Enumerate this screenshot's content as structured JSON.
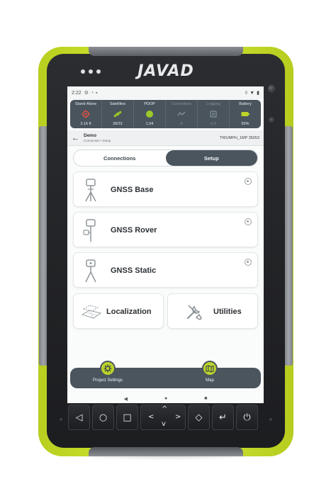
{
  "device": {
    "brand": "JAVAD",
    "lime_color": "#c9e12b",
    "bezel_color": "#232427"
  },
  "status_bar": {
    "time": "2:22",
    "icons": [
      "settings-icon",
      "sync-icon",
      "notification-icon"
    ],
    "right_icons": [
      "vibrate-icon",
      "wifi-icon",
      "battery-icon"
    ]
  },
  "gnss_panel": {
    "cells": [
      {
        "label": "Stand-Alone",
        "value": "3.16 ft",
        "color": "#e0523f",
        "icon": "target-icon",
        "dim": false
      },
      {
        "label": "Satellites",
        "value": "28/31",
        "color": "#9cc92a",
        "icon": "satellite-icon",
        "dim": false
      },
      {
        "label": "PDOP",
        "value": "1.04",
        "color": "#9cc92a",
        "icon": "dot-icon",
        "dim": false
      },
      {
        "label": "Corrections",
        "value": "0",
        "color": "#87939b",
        "icon": "signal-icon",
        "dim": true
      },
      {
        "label": "Logging",
        "value": "0.0",
        "color": "#87939b",
        "icon": "log-icon",
        "dim": true
      },
      {
        "label": "Battery",
        "value": "93%",
        "color": "#bcd42a",
        "icon": "battery-icon",
        "dim": false
      }
    ]
  },
  "title_bar": {
    "title": "Demo",
    "subtitle": "Connection / Setup",
    "receiver": "TRIUMPH_1MP  35053"
  },
  "tabs": {
    "connections": "Connections",
    "setup": "Setup",
    "active": "setup"
  },
  "setup_items": {
    "gnss_base": "GNSS Base",
    "gnss_rover": "GNSS Rover",
    "gnss_static": "GNSS Static",
    "localization": "Localization",
    "utilities": "Utilities"
  },
  "bottom_nav": {
    "project_settings": "Project Settings",
    "map": "Map"
  },
  "system_nav": {
    "back": "◀",
    "home": "●",
    "recents": "■"
  },
  "keypad": {
    "back": "◁",
    "home": "○",
    "recents": "□",
    "up": "^",
    "left": "<",
    "right": ">",
    "down": "v",
    "diamond": "◇",
    "enter": "↵",
    "power": "⏻"
  }
}
